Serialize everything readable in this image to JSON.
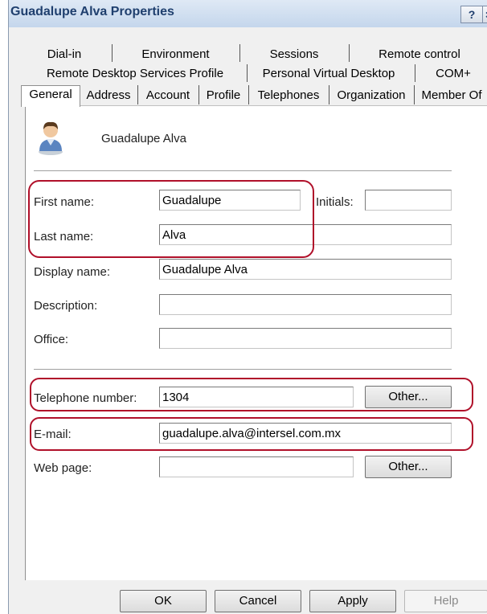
{
  "window": {
    "title": "Guadalupe Alva Properties",
    "help_btn": "?",
    "close_btn": "×"
  },
  "tabs": {
    "row1": [
      "Dial-in",
      "Environment",
      "Sessions",
      "Remote control"
    ],
    "row2": [
      "Remote Desktop Services Profile",
      "Personal Virtual Desktop",
      "COM+"
    ],
    "row3": [
      "General",
      "Address",
      "Account",
      "Profile",
      "Telephones",
      "Organization",
      "Member Of"
    ],
    "selected": "General"
  },
  "header": {
    "icon": "user-icon",
    "display": "Guadalupe Alva"
  },
  "form": {
    "first_name": {
      "label": "First name:",
      "value": "Guadalupe"
    },
    "initials": {
      "label": "Initials:",
      "value": ""
    },
    "last_name": {
      "label": "Last name:",
      "value": "Alva"
    },
    "display_name": {
      "label": "Display name:",
      "value": "Guadalupe Alva"
    },
    "description": {
      "label": "Description:",
      "value": ""
    },
    "office": {
      "label": "Office:",
      "value": ""
    },
    "telephone": {
      "label": "Telephone number:",
      "value": "1304",
      "other": "Other..."
    },
    "email": {
      "label": "E-mail:",
      "value": "guadalupe.alva@intersel.com.mx"
    },
    "web_page": {
      "label": "Web page:",
      "value": "",
      "other": "Other..."
    }
  },
  "buttons": {
    "ok": "OK",
    "cancel": "Cancel",
    "apply": "Apply",
    "help": "Help"
  },
  "colors": {
    "highlight": "#b0102a",
    "title_text": "#1f3f6e"
  }
}
